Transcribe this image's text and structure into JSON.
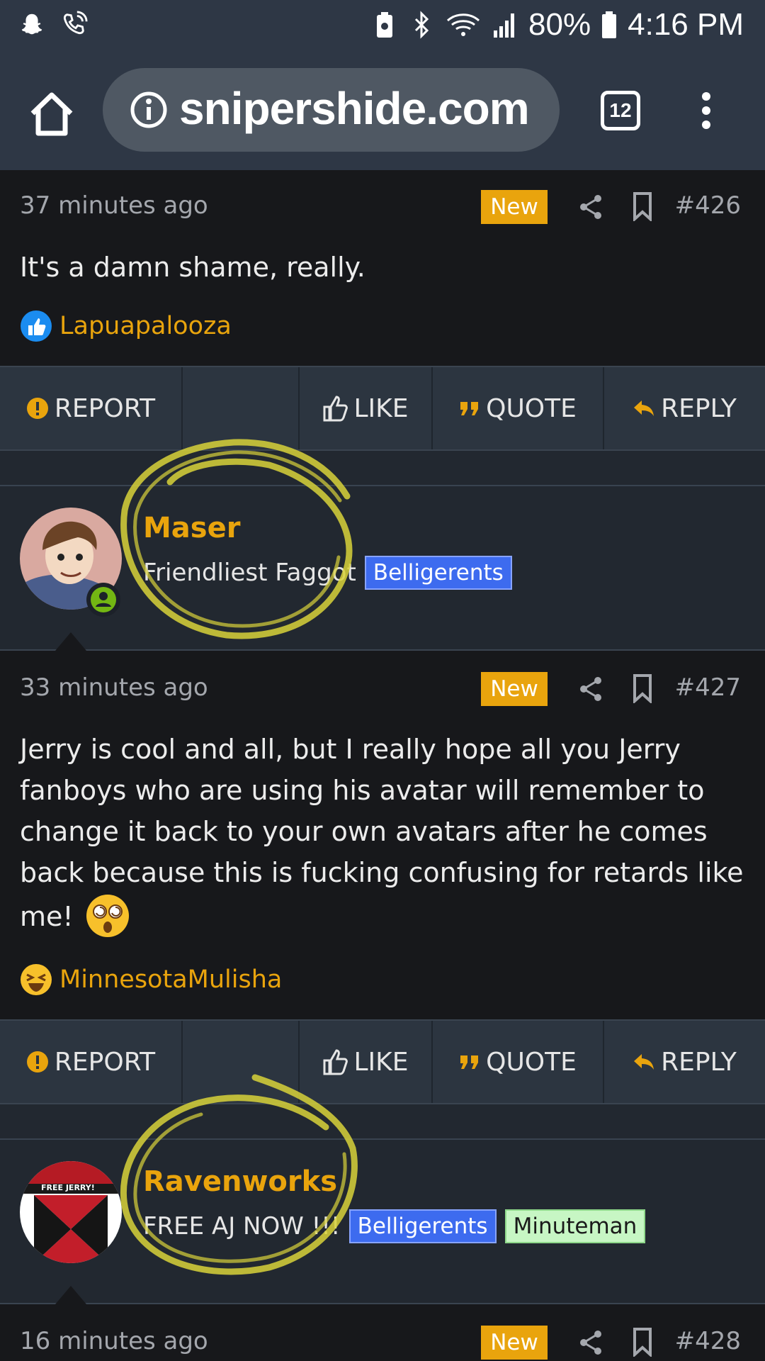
{
  "status_bar": {
    "battery": "80%",
    "time": "4:16 PM"
  },
  "browser": {
    "url": "snipershide.com",
    "tab_count": "12"
  },
  "posts": [
    {
      "time": "37 minutes ago",
      "new_badge": "New",
      "number": "#426",
      "body": "It's a damn shame, really.",
      "reaction_user": "Lapuapalooza"
    },
    {
      "author": "Maser",
      "user_title": "Friendliest Faggot",
      "tags": [
        "Belligerents"
      ],
      "time": "33 minutes ago",
      "new_badge": "New",
      "number": "#427",
      "body": "Jerry is cool and all, but I really hope all you Jerry fanboys who are using his avatar will remember to change it back to your own avatars after he comes back because this is fucking confusing for retards like me!",
      "reaction_user": "MinnesotaMulisha"
    },
    {
      "author": "Ravenworks",
      "user_title": "FREE AJ NOW !!!",
      "tags": [
        "Belligerents",
        "Minuteman"
      ],
      "avatar_text": "FREE JERRY!",
      "time": "16 minutes ago",
      "new_badge": "New",
      "number": "#428"
    }
  ],
  "actions": {
    "report": "REPORT",
    "like": "LIKE",
    "quote": "QUOTE",
    "reply": "REPLY"
  },
  "colors": {
    "accent": "#e9a40d",
    "background": "#17181b",
    "bar": "#2c3540",
    "tag_blue": "#3d6bef",
    "tag_green": "#c7f6c4",
    "annotation": "#d8d23a"
  }
}
